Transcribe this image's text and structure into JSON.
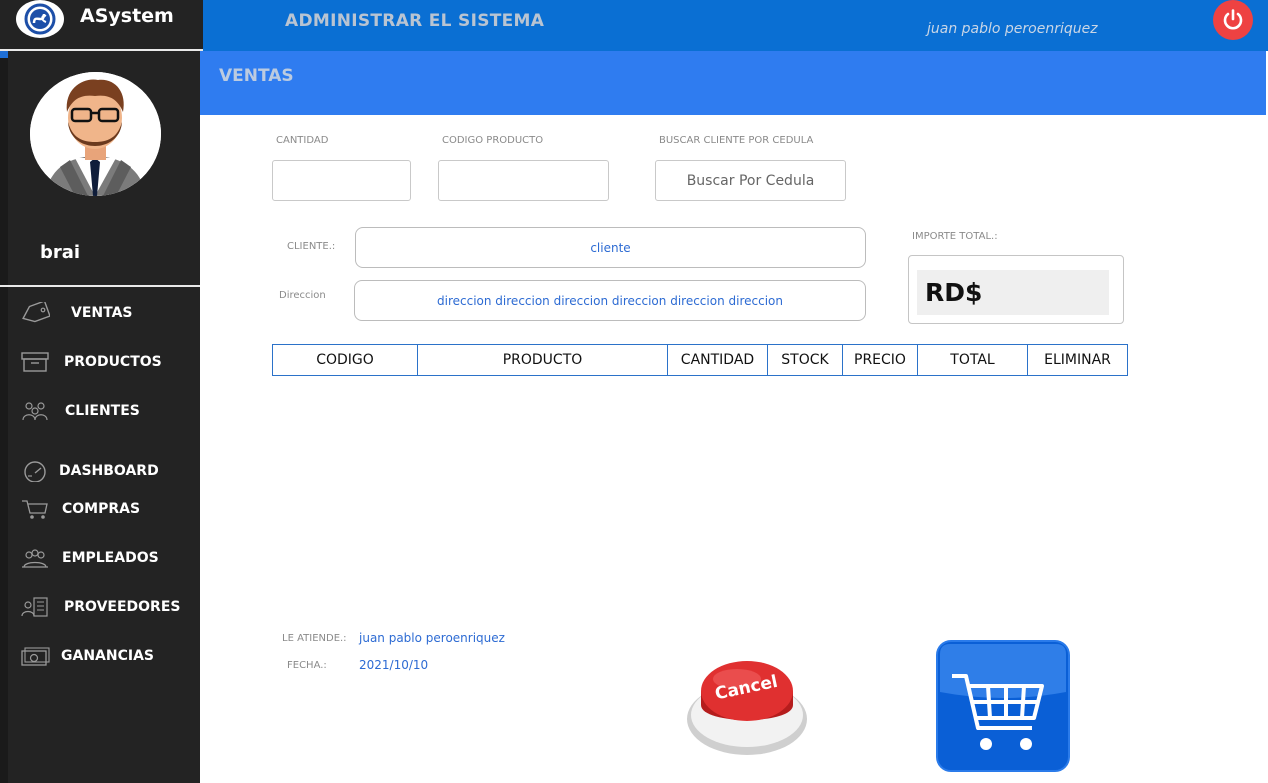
{
  "app": {
    "name": "ASystem",
    "title": "ADMINISTRAR EL SISTEMA",
    "logged_user": "juan pablo peroenriquez"
  },
  "sidebar": {
    "profile_name": "brai",
    "items": [
      {
        "label": "VENTAS",
        "icon": "tag-icon"
      },
      {
        "label": "PRODUCTOS",
        "icon": "box-icon"
      },
      {
        "label": "CLIENTES",
        "icon": "people-icon"
      },
      {
        "label": "DASHBOARD",
        "icon": "gauge-icon"
      },
      {
        "label": "COMPRAS",
        "icon": "cart-icon"
      },
      {
        "label": "EMPLEADOS",
        "icon": "employees-icon"
      },
      {
        "label": "PROVEEDORES",
        "icon": "suppliers-icon"
      },
      {
        "label": "GANANCIAS",
        "icon": "money-icon"
      }
    ]
  },
  "section": {
    "title": "VENTAS"
  },
  "form": {
    "cantidad_label": "CANTIDAD",
    "codigo_label": "CODIGO PRODUCTO",
    "buscar_label": "BUSCAR CLIENTE POR CEDULA",
    "buscar_button": "Buscar Por Cedula",
    "cliente_label": "CLIENTE.:",
    "cliente_value": "cliente",
    "direccion_label": "Direccion",
    "direccion_value": "direccion direccion direccion direccion direccion direccion",
    "importe_label": "IMPORTE TOTAL.:",
    "importe_value": "RD$"
  },
  "table": {
    "headers": [
      "CODIGO",
      "PRODUCTO",
      "CANTIDAD",
      "STOCK",
      "PRECIO",
      "TOTAL",
      "ELIMINAR"
    ]
  },
  "footer": {
    "atiende_label": "LE ATIENDE.:",
    "atiende_value": "juan pablo peroenriquez",
    "fecha_label": "FECHA.:",
    "fecha_value": "2021/10/10"
  },
  "buttons": {
    "cancel_label": "Cancel"
  },
  "colors": {
    "topbar": "#0a6fd3",
    "secbar": "#2f7cf0",
    "sidebar": "#232323",
    "power": "#ee4242"
  }
}
